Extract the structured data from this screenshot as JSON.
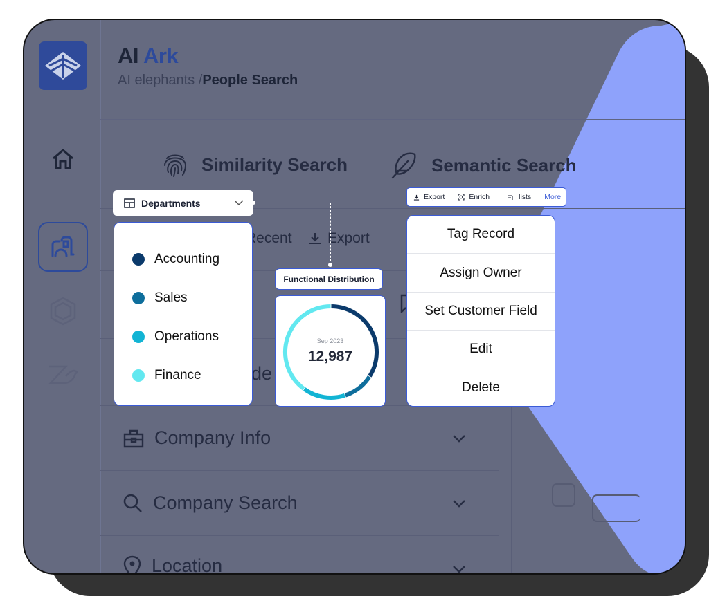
{
  "app": {
    "title_prefix": "AI",
    "title_brand": "Ark",
    "breadcrumb_parent": "AI elephants /",
    "breadcrumb_current": "People Search"
  },
  "sidebar": {
    "items": [
      {
        "icon": "home-icon",
        "active": false
      },
      {
        "icon": "people-search-icon",
        "active": true
      },
      {
        "icon": "hexagon-icon",
        "active": false
      },
      {
        "icon": "bird-icon",
        "active": false
      }
    ]
  },
  "tabs": [
    {
      "label": "Similarity Search",
      "icon": "fingerprint-icon"
    },
    {
      "label": "Semantic Search",
      "icon": "feather-icon"
    }
  ],
  "sub_actions": {
    "recent_label": "Recent",
    "export_label": "Export"
  },
  "filters": [
    {
      "label": "Company Info",
      "icon": "briefcase-icon"
    },
    {
      "label": "Company Search",
      "icon": "search-icon"
    },
    {
      "label": "Location",
      "icon": "location-pin-icon"
    }
  ],
  "background_partial_text": "de",
  "departments_dropdown": {
    "label": "Departments",
    "icon": "table-icon",
    "items": [
      {
        "label": "Accounting",
        "color": "#0b3a6b"
      },
      {
        "label": "Sales",
        "color": "#0e6e9c"
      },
      {
        "label": "Operations",
        "color": "#12b4d4"
      },
      {
        "label": "Finance",
        "color": "#62e8f0"
      }
    ]
  },
  "functional_distribution": {
    "title": "Functional Distribution",
    "period": "Sep 2023",
    "total": "12,987"
  },
  "chart_data": {
    "type": "pie",
    "title": "Functional Distribution",
    "subtitle": "Sep 2023",
    "center_label": "12,987",
    "categories": [
      "Accounting",
      "Sales",
      "Operations",
      "Finance"
    ],
    "values": [
      34,
      11,
      15,
      40
    ],
    "colors": [
      "#0b3a6b",
      "#0e6e9c",
      "#12b4d4",
      "#62e8f0"
    ],
    "donut": true
  },
  "toolbar": {
    "buttons": [
      {
        "label": "Export",
        "icon": "download-icon"
      },
      {
        "label": "Enrich",
        "icon": "enrich-icon"
      },
      {
        "label": "lists",
        "icon": "add-list-icon"
      },
      {
        "label": "More",
        "icon": ""
      }
    ]
  },
  "action_menu": {
    "items": [
      "Tag Record",
      "Assign Owner",
      "Set Customer Field",
      "Edit",
      "Delete"
    ]
  },
  "colors": {
    "accent": "#3b5bd6",
    "brand": "#2d4a9b",
    "overlay_shape": "#8ea2fb",
    "dim_background": "#656a80"
  }
}
